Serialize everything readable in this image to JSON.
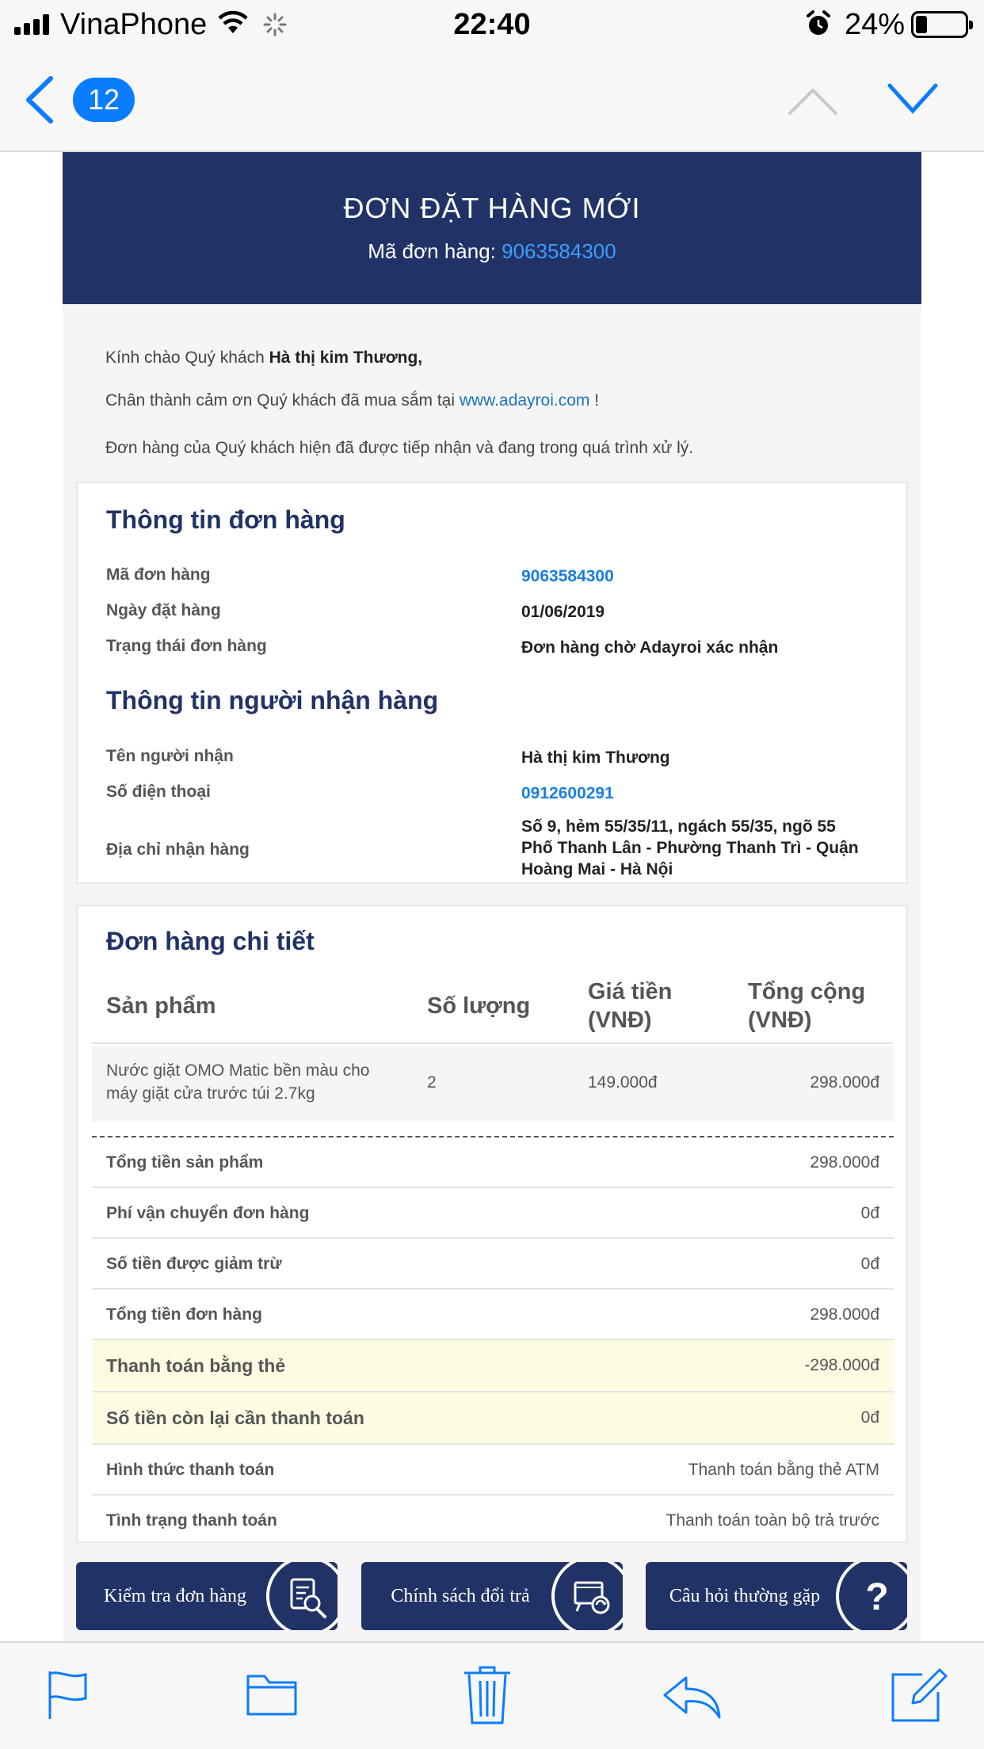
{
  "status_bar": {
    "carrier": "VinaPhone",
    "time": "22:40",
    "battery_percent": "24%",
    "battery_level": 0.24,
    "icons": [
      "signal-icon",
      "wifi-icon",
      "loading-spinner-icon",
      "alarm-icon",
      "battery-icon"
    ]
  },
  "nav": {
    "unread_count": "12",
    "icons": [
      "back-chevron-icon",
      "up-arrow-icon",
      "down-arrow-icon"
    ]
  },
  "hero": {
    "title": "ĐƠN ĐẶT HÀNG MỚI",
    "order_code_label": "Mã đơn hàng: ",
    "order_code": "9063584300",
    "bg_color": "#213366"
  },
  "greeting": {
    "line1_prefix": "Kính chào Quý khách ",
    "customer_name": "Hà thị kim Thương,",
    "line2_prefix": "Chân thành cảm ơn Quý khách đã mua sắm tại ",
    "site_link": "www.adayroi.com",
    "line2_suffix": " !",
    "line3": "Đơn hàng của Quý khách hiện đã được tiếp nhận và đang trong quá trình xử lý."
  },
  "order_info": {
    "title": "Thông tin đơn hàng",
    "rows": [
      {
        "label": "Mã đơn hàng",
        "value": "9063584300"
      },
      {
        "label": "Ngày đặt hàng",
        "value": "01/06/2019"
      },
      {
        "label": "Trạng thái đơn hàng",
        "value": "Đơn hàng chờ Adayroi xác nhận"
      }
    ]
  },
  "recipient_info": {
    "title": "Thông tin người nhận hàng",
    "rows": [
      {
        "label": "Tên người nhận",
        "value": "Hà thị kim Thương"
      },
      {
        "label": "Số điện thoại",
        "value": "0912600291"
      },
      {
        "label": "Địa chỉ nhận hàng",
        "value_lines": [
          "Số 9, hẻm 55/35/11, ngách 55/35, ngõ 55",
          "Phố Thanh Lân  - Phường Thanh Trì  - Quận",
          "Hoàng Mai  - Hà Nội"
        ]
      }
    ]
  },
  "order_detail": {
    "title": "Đơn hàng chi tiết",
    "columns": {
      "product": "Sản phẩm",
      "quantity": "Số lượng",
      "price_line1": "Giá tiền",
      "price_line2": "(VNĐ)",
      "total_line1": "Tổng cộng",
      "total_line2": "(VNĐ)"
    },
    "items": [
      {
        "name_lines": [
          "Nước giặt OMO Matic bền màu cho",
          "máy giặt cửa trước túi 2.7kg"
        ],
        "quantity": "2",
        "price": "149.000đ",
        "total": "298.000đ"
      }
    ],
    "summary": [
      {
        "label": "Tổng tiền sản phẩm",
        "value": "298.000đ",
        "highlight": false
      },
      {
        "label": "Phí vận chuyển đơn hàng",
        "value": "0đ",
        "highlight": false
      },
      {
        "label": "Số tiền được giảm trừ",
        "value": "0đ",
        "highlight": false
      },
      {
        "label": "Tổng tiền đơn hàng",
        "value": "298.000đ",
        "highlight": false
      },
      {
        "label": "Thanh toán bằng thẻ",
        "value": "-298.000đ",
        "highlight": true
      },
      {
        "label": "Số tiền còn lại cần thanh toán",
        "value": "0đ",
        "highlight": true
      },
      {
        "label": "Hình thức thanh toán",
        "value": "Thanh toán bằng thẻ ATM",
        "highlight": false
      },
      {
        "label": "Tình trạng thanh toán",
        "value": "Thanh toán toàn bộ trả trước",
        "highlight": false
      }
    ],
    "highlight_color": "#fefbe3"
  },
  "action_buttons": [
    {
      "label": "Kiểm tra đơn hàng",
      "icon": "order-search-icon"
    },
    {
      "label": "Chính sách đổi trả",
      "icon": "return-policy-icon"
    },
    {
      "label": "Câu hỏi thường gặp",
      "icon": "question-mark-icon"
    }
  ],
  "toolbar": {
    "icons": [
      "flag-icon",
      "folder-icon",
      "trash-icon",
      "reply-icon",
      "compose-icon"
    ],
    "accent_color": "#0a7cff"
  }
}
